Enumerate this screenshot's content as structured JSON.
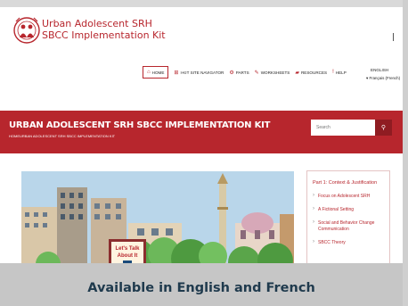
{
  "header": {
    "brand_line1": "Urban Adolescent SRH",
    "brand_line2": "SBCC Implementation Kit"
  },
  "nav": {
    "items": [
      {
        "label": "HOME",
        "icon": "home-icon"
      },
      {
        "label": "I-KIT SITE NAVIGATOR",
        "icon": "sitemap-icon"
      },
      {
        "label": "PARTS",
        "icon": "gear-icon"
      },
      {
        "label": "WORKSHEETS",
        "icon": "pencil-icon"
      },
      {
        "label": "RESOURCES",
        "icon": "book-icon"
      },
      {
        "label": "HELP",
        "icon": "question-icon"
      }
    ],
    "language": "ENGLISH",
    "language_option": "Français (French)"
  },
  "banner": {
    "title": "URBAN ADOLESCENT SRH SBCC IMPLEMENTATION KIT",
    "breadcrumb": "HOMEURBAN ADOLESCENT SRH SBCC IMPLEMENTATION KIT",
    "search_placeholder": "Search",
    "color": "#b7262d"
  },
  "hero": {
    "sign_text": "Let's Talk About It"
  },
  "sidebar": {
    "heading": "Part 1: Context & Justification",
    "items": [
      "Focus on Adolescent SRH",
      "A Fictional Setting",
      "Social and Behavior Change Communication",
      "SBCC Theory"
    ]
  },
  "caption": "Available in English and French"
}
